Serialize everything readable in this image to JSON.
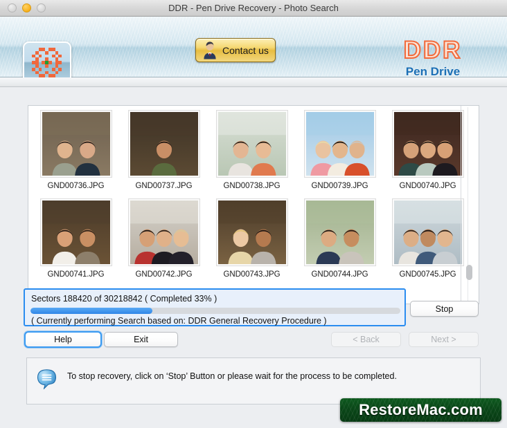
{
  "window": {
    "title": "DDR - Pen Drive Recovery - Photo Search",
    "traffic_lights": [
      "close-disabled",
      "minimize-active",
      "zoom-disabled"
    ]
  },
  "header": {
    "logo_icon": "checkered-flower-logo-icon",
    "contact_button": {
      "label": "Contact us",
      "icon": "person-avatar-icon"
    },
    "brand_title": "DDR",
    "brand_subtitle": "Pen Drive",
    "brand_color": "#f2693a",
    "brand_sub_color": "#1b6fb5"
  },
  "photo_panel": {
    "photos": [
      {
        "name": "GND00736.JPG",
        "alt": "smiling-couple-outdoors"
      },
      {
        "name": "GND00737.JPG",
        "alt": "smiling-woman-green-jacket"
      },
      {
        "name": "GND00738.JPG",
        "alt": "two-women-under-blossom-tree"
      },
      {
        "name": "GND00739.JPG",
        "alt": "three-seniors-laughing"
      },
      {
        "name": "GND00740.JPG",
        "alt": "three-friends-retro-portrait"
      },
      {
        "name": "GND00741.JPG",
        "alt": "young-couple-embracing"
      },
      {
        "name": "GND00742.JPG",
        "alt": "group-of-friends-on-couch"
      },
      {
        "name": "GND00743.JPG",
        "alt": "blonde-woman-and-man-smiling"
      },
      {
        "name": "GND00744.JPG",
        "alt": "two-men-sitting-outdoors"
      },
      {
        "name": "GND00745.JPG",
        "alt": "friends-toasting-drinks"
      }
    ]
  },
  "progress": {
    "label": "Sectors  188420 of 30218842    ( Completed 33% )",
    "sectors_done": 188420,
    "sectors_total": 30218842,
    "percent": 33,
    "status": "( Currently performing Search based on: DDR General Recovery Procedure )",
    "fill_color": "#2f86e8",
    "border_color": "#2a8cf0"
  },
  "buttons": {
    "stop": "Stop",
    "help": "Help",
    "exit": "Exit",
    "back": "< Back",
    "next": "Next >"
  },
  "info": {
    "icon": "speech-bubble-info-icon",
    "message": "To stop recovery, click on ‘Stop’ Button or please wait for the process to be completed."
  },
  "watermark": {
    "text": "RestoreMac.com",
    "background_color": "#0a4718"
  }
}
